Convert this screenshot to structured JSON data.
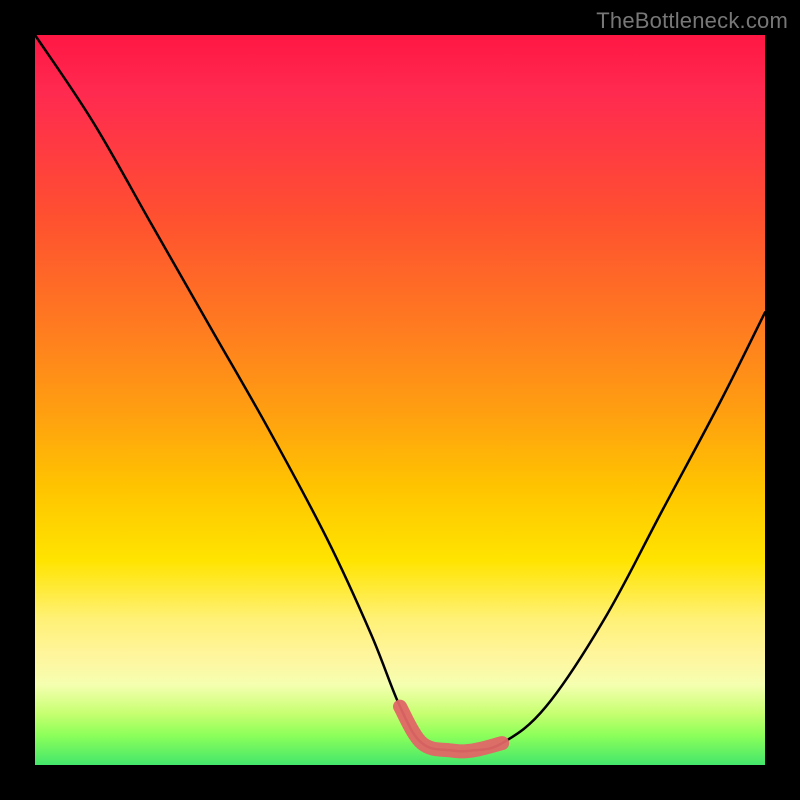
{
  "watermark": {
    "text": "TheBottleneck.com"
  },
  "chart_data": {
    "type": "line",
    "title": "",
    "xlabel": "",
    "ylabel": "",
    "xlim": [
      0,
      100
    ],
    "ylim": [
      0,
      100
    ],
    "series": [
      {
        "name": "curve",
        "x": [
          0,
          8,
          16,
          24,
          32,
          40,
          46,
          50,
          53,
          57,
          60,
          64,
          70,
          78,
          86,
          94,
          100
        ],
        "values": [
          100,
          88,
          74,
          60,
          46,
          31,
          18,
          8,
          3,
          2,
          2,
          3,
          8,
          20,
          35,
          50,
          62
        ]
      },
      {
        "name": "highlight",
        "x": [
          50,
          53,
          57,
          60,
          64
        ],
        "values": [
          8,
          3,
          2,
          2,
          3
        ]
      }
    ]
  }
}
